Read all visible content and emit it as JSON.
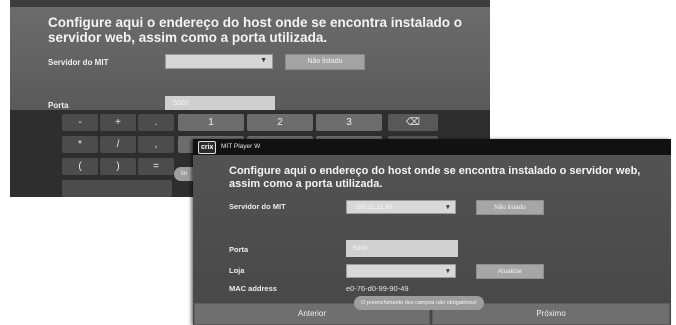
{
  "background_window": {
    "heading": "Configure aqui o endereço do host onde se encontra instalado o servidor web, assim como a porta utilizada.",
    "server_label": "Servidor do MIT",
    "not_listed_button": "Não listado",
    "port_label": "Porta",
    "port_value": "5000",
    "hint_partial": "lin",
    "keyboard": {
      "row1": [
        "-",
        "+",
        ".",
        "1",
        "2",
        "3",
        "⌫"
      ],
      "row2": [
        "*",
        "/",
        ","
      ],
      "row3": [
        "(",
        ")",
        "="
      ]
    }
  },
  "window": {
    "logo": "crix",
    "title": "MIT Player W",
    "heading": "Configure aqui o endereço do host onde se encontra instalado o servidor web, assim como a porta utilizada.",
    "server_label": "Servidor do MIT",
    "server_value": "192.11.11.30",
    "not_listed_button": "Não listado",
    "port_label": "Porta",
    "port_value": "5000",
    "store_label": "Loja",
    "store_value": "",
    "update_button": "Atualizar",
    "mac_label": "MAC address",
    "mac_value": "e0-76-d0-99-90-49",
    "toast": "O preenchimento dos campos não obrigatórios!",
    "prev_button": "Anterior",
    "next_button": "Próximo"
  }
}
